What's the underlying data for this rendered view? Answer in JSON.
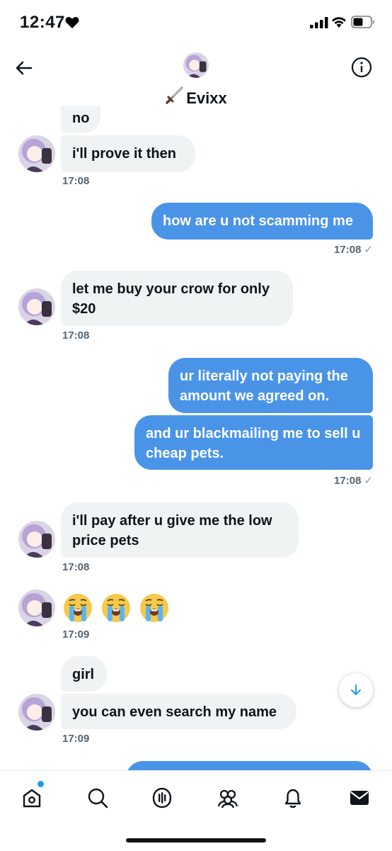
{
  "status_bar": {
    "time": "12:47"
  },
  "header": {
    "title": "Evixx"
  },
  "messages": {
    "m1": "no",
    "m2": "i'll prove it then",
    "t1": "17:08",
    "m3": "how are u not scamming me",
    "t2": "17:08",
    "m4": "let me buy your crow for only $20",
    "t3": "17:08",
    "m5": "ur literally not paying the amount we agreed on.",
    "m6": "and ur blackmailing me to sell u cheap pets.",
    "t4": "17:08",
    "m7": "i'll pay after u give me the low price pets",
    "t5": "17:08",
    "emojis": [
      "😭",
      "😭",
      "😭"
    ],
    "t6": "17:09",
    "m8": "girl",
    "m9": "you can even search my name",
    "t7": "17:09"
  },
  "sent_check": "✓",
  "icons": {
    "back": "arrow-left-icon",
    "info": "info-icon",
    "home": "home-icon",
    "search": "search-icon",
    "spaces": "spaces-icon",
    "communities": "communities-icon",
    "notifications": "bell-icon",
    "messages": "envelope-icon"
  },
  "colors": {
    "sent_bubble": "#4a94e8",
    "received_bubble": "#eff3f4",
    "accent": "#1d9bf0"
  }
}
